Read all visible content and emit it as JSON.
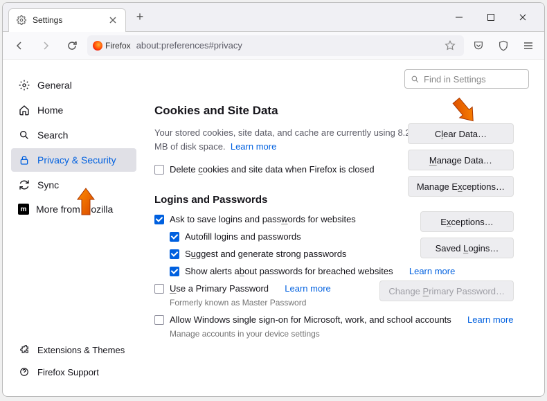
{
  "tab": {
    "title": "Settings"
  },
  "address": {
    "brand": "Firefox",
    "url": "about:preferences#privacy"
  },
  "search": {
    "placeholder": "Find in Settings"
  },
  "sidebar": {
    "items": [
      {
        "label": "General"
      },
      {
        "label": "Home"
      },
      {
        "label": "Search"
      },
      {
        "label": "Privacy & Security"
      },
      {
        "label": "Sync"
      },
      {
        "label": "More from Mozilla"
      }
    ],
    "footer": [
      {
        "label": "Extensions & Themes"
      },
      {
        "label": "Firefox Support"
      }
    ]
  },
  "cookies": {
    "heading": "Cookies and Site Data",
    "desc_pre": "Your stored cookies, site data, and cache are currently using ",
    "usage": "8.2 MB",
    "desc_post": " of disk space.",
    "learn_more": "Learn more",
    "delete_label": "Delete cookies and site data when Firefox is closed",
    "buttons": {
      "clear": "Clear Data…",
      "manage": "Manage Data…",
      "exceptions": "Manage Exceptions…"
    }
  },
  "logins": {
    "heading": "Logins and Passwords",
    "ask_save": "Ask to save logins and passwords for websites",
    "autofill": "Autofill logins and passwords",
    "suggest": "Suggest and generate strong passwords",
    "alerts": "Show alerts about passwords for breached websites",
    "alerts_link": "Learn more",
    "primary": "Use a Primary Password",
    "primary_link": "Learn more",
    "primary_note": "Formerly known as Master Password",
    "sso": "Allow Windows single sign-on for Microsoft, work, and school accounts",
    "sso_link": "Learn more",
    "sso_note": "Manage accounts in your device settings",
    "buttons": {
      "exceptions": "Exceptions…",
      "saved": "Saved Logins…",
      "change_primary": "Change Primary Password…"
    }
  }
}
